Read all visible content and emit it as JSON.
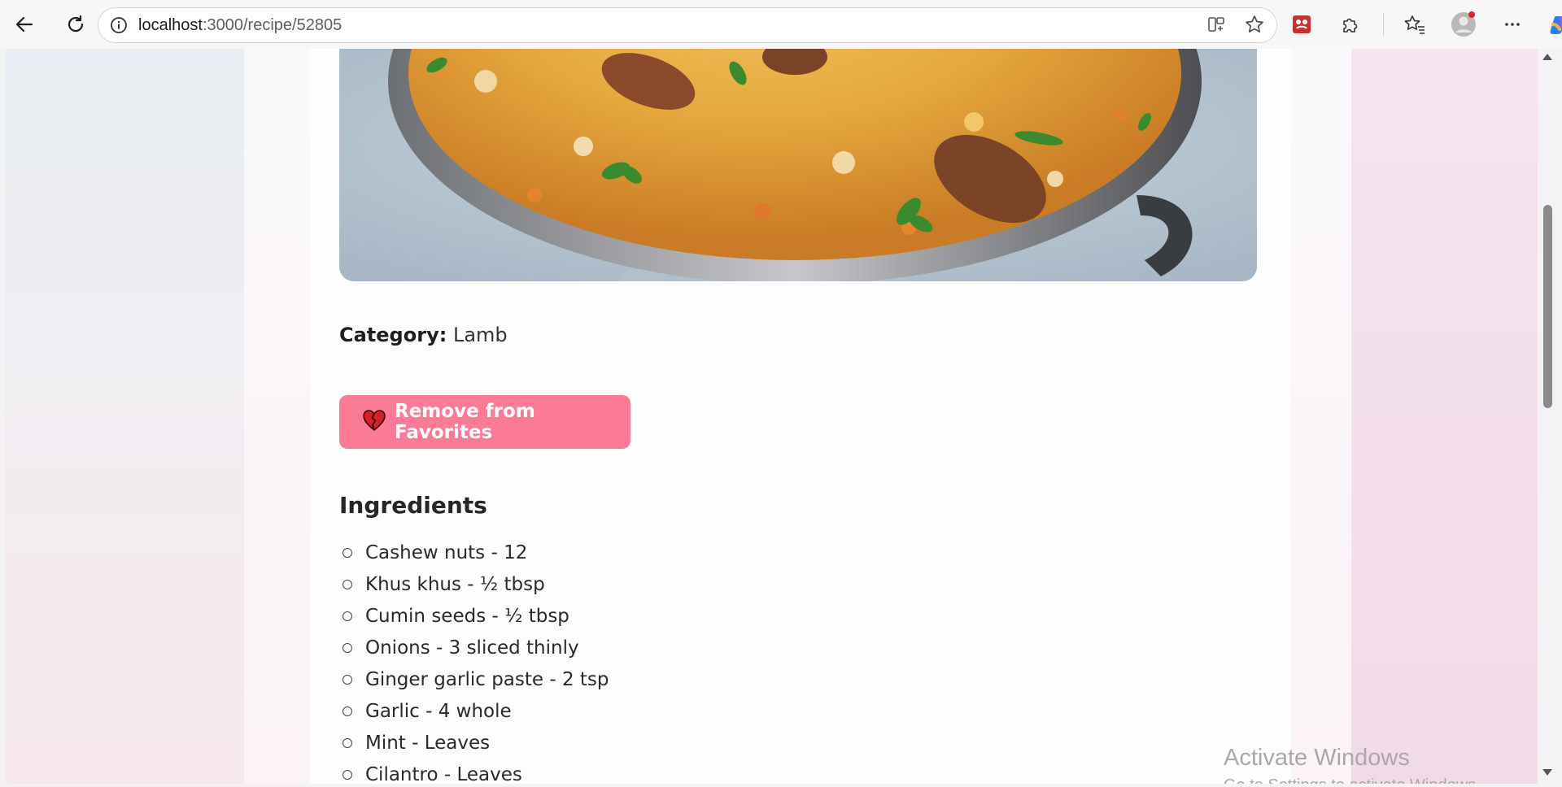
{
  "browser": {
    "url_host": "localhost",
    "url_path": ":3000/recipe/52805",
    "icons": {
      "back": "back-arrow-icon",
      "reload": "reload-icon",
      "info": "info-icon",
      "split": "split-screen-icon",
      "star": "favorite-star-icon",
      "extension1": "red-extension-icon",
      "extensions": "puzzle-icon",
      "favorites": "favorites-list-icon",
      "profile": "profile-avatar-icon",
      "more": "more-options-icon",
      "copilot": "copilot-icon"
    }
  },
  "recipe": {
    "category_label": "Category:",
    "category_value": "Lamb",
    "favorite_button": "Remove from Favorites",
    "favorite_icon": "broken-heart-icon",
    "ingredients_title": "Ingredients",
    "ingredients": [
      "Cashew nuts - 12",
      "Khus khus - ½ tbsp",
      "Cumin seeds - ½ tbsp",
      "Onions - 3 sliced thinly",
      "Ginger garlic paste - 2 tsp",
      "Garlic - 4 whole",
      "Mint - Leaves",
      "Cilantro - Leaves"
    ]
  },
  "colors": {
    "button_bg": "#fb7b97",
    "button_text": "#ffffff"
  },
  "watermark": {
    "line1": "Activate Windows",
    "line2": "Go to Settings to activate Windows."
  }
}
